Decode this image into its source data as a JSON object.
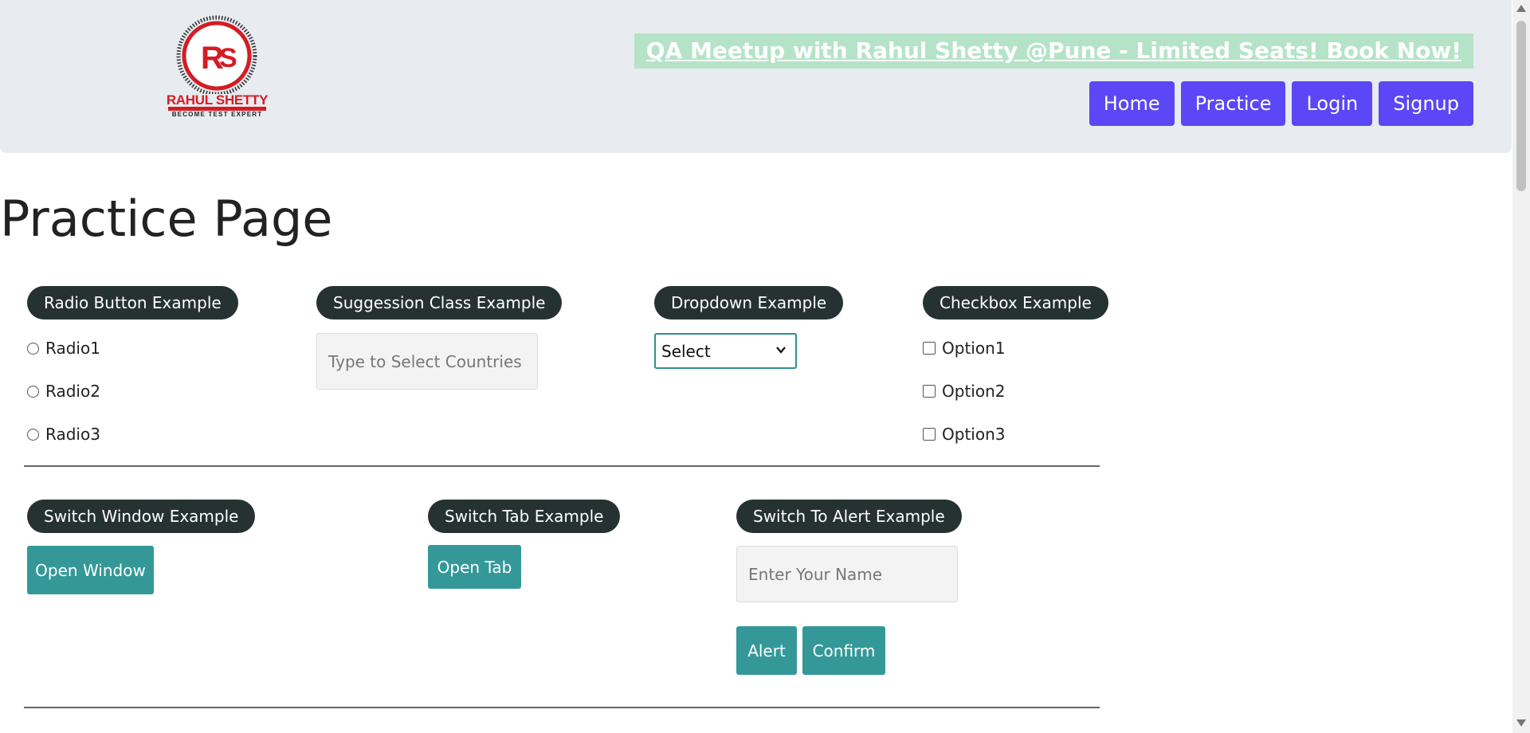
{
  "header": {
    "logo": {
      "initials": "RS",
      "name": "RAHUL SHETTY",
      "tagline": "BECOME TEST EXPERT",
      "colors": {
        "primary": "#d41c24"
      }
    },
    "promo_text": "QA Meetup with Rahul Shetty @Pune - Limited Seats! Book Now!",
    "nav": [
      {
        "label": "Home"
      },
      {
        "label": "Practice"
      },
      {
        "label": "Login"
      },
      {
        "label": "Signup"
      }
    ]
  },
  "page_title": "Practice Page",
  "radio_section": {
    "legend": "Radio Button Example",
    "options": [
      "Radio1",
      "Radio2",
      "Radio3"
    ]
  },
  "suggestion_section": {
    "legend": "Suggession Class Example",
    "placeholder": "Type to Select Countries"
  },
  "dropdown_section": {
    "legend": "Dropdown Example",
    "selected": "Select"
  },
  "checkbox_section": {
    "legend": "Checkbox Example",
    "options": [
      "Option1",
      "Option2",
      "Option3"
    ]
  },
  "switch_window_section": {
    "legend": "Switch Window Example",
    "button": "Open Window"
  },
  "switch_tab_section": {
    "legend": "Switch Tab Example",
    "button": "Open Tab"
  },
  "alert_section": {
    "legend": "Switch To Alert Example",
    "placeholder": "Enter Your Name",
    "alert_button": "Alert",
    "confirm_button": "Confirm"
  },
  "colors": {
    "nav_button": "#5b47f5",
    "legend_bg": "#263232",
    "teal_button": "#349898",
    "header_bg": "#e8ebef",
    "promo_bg": "#b5e3c7"
  }
}
